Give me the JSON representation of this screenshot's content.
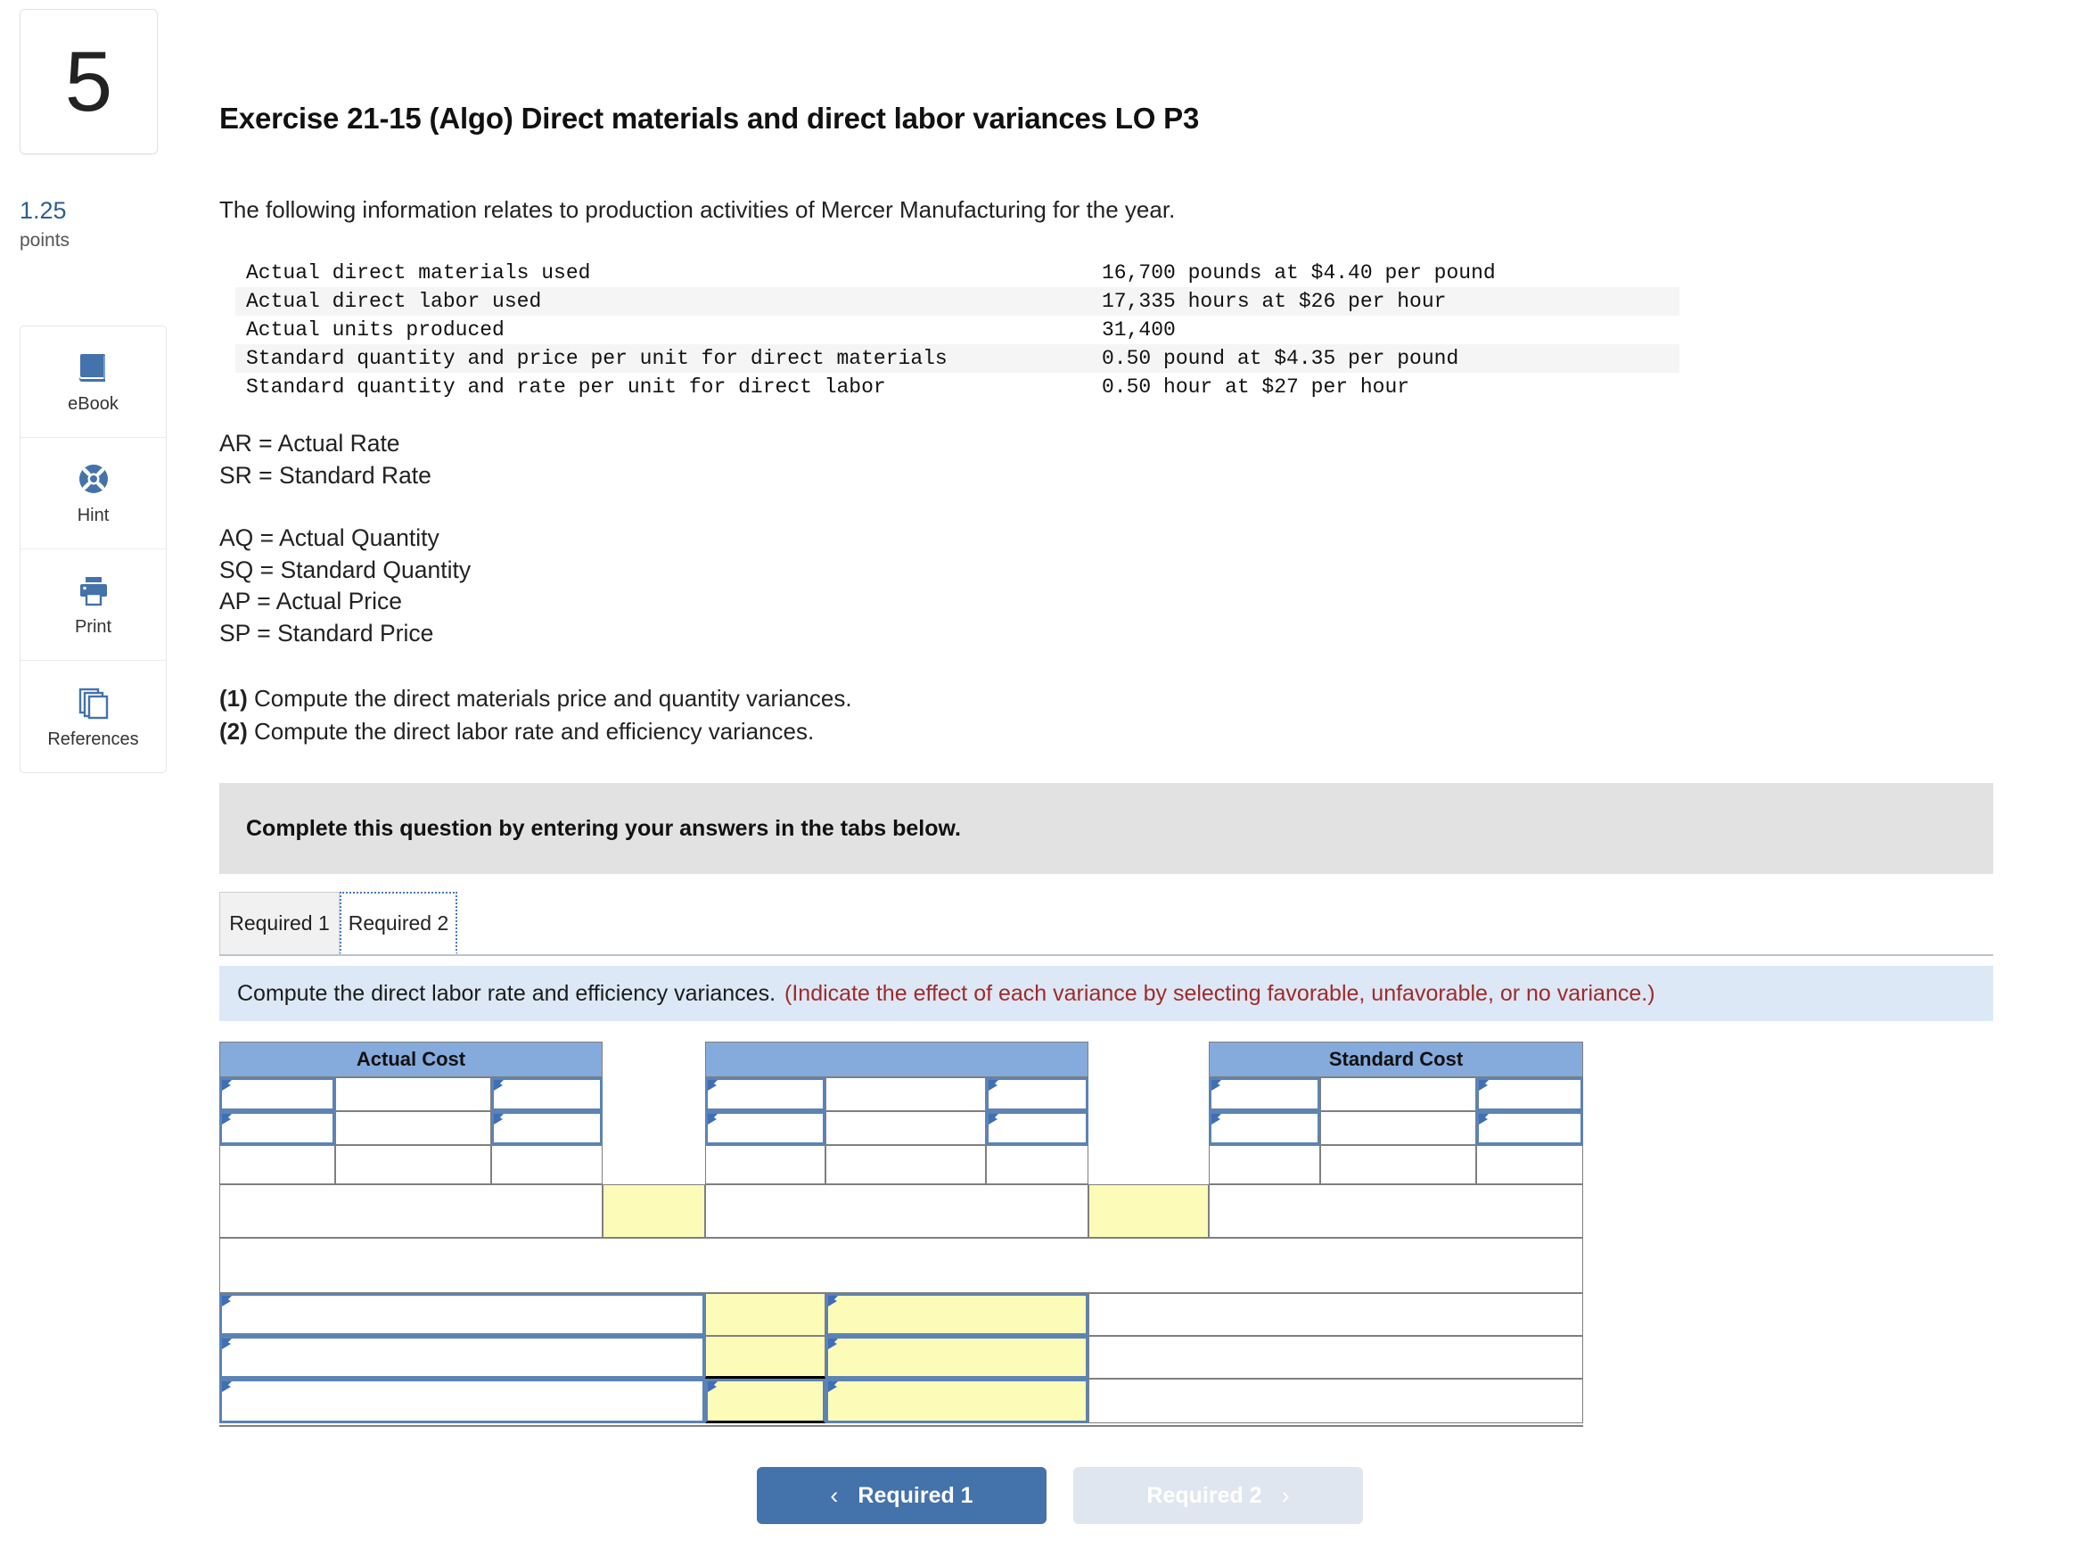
{
  "left_rail": {
    "question_number": "5",
    "points_value": "1.25",
    "points_label": "points",
    "tools": [
      {
        "icon": "ebook-icon",
        "label": "eBook"
      },
      {
        "icon": "hint-lifebuoy-icon",
        "label": "Hint"
      },
      {
        "icon": "printer-icon",
        "label": "Print"
      },
      {
        "icon": "references-pages-icon",
        "label": "References"
      }
    ]
  },
  "exercise": {
    "title": "Exercise 21-15 (Algo) Direct materials and direct labor variances LO P3",
    "intro": "The following information relates to production activities of Mercer Manufacturing for the year."
  },
  "facts_table": {
    "rows": [
      {
        "label": "Actual direct materials used",
        "value": "16,700 pounds at $4.40 per pound"
      },
      {
        "label": "Actual direct labor used",
        "value": "17,335 hours at $26 per hour"
      },
      {
        "label": "Actual units produced",
        "value": "31,400"
      },
      {
        "label": "Standard quantity and price per unit for direct materials",
        "value": "0.50 pound at $4.35 per pound"
      },
      {
        "label": "Standard quantity and rate per unit for direct labor",
        "value": "0.50 hour at $27 per hour"
      }
    ]
  },
  "definitions": {
    "group1": [
      "AR = Actual Rate",
      "SR = Standard Rate"
    ],
    "group2": [
      "AQ = Actual Quantity",
      "SQ = Standard Quantity",
      "AP = Actual Price",
      "SP = Standard Price"
    ]
  },
  "requirements": [
    {
      "num": "(1)",
      "text": " Compute the direct materials price and quantity variances."
    },
    {
      "num": "(2)",
      "text": " Compute the direct labor rate and efficiency variances."
    }
  ],
  "complete_banner": "Complete this question by entering your answers in the tabs below.",
  "tabs": [
    {
      "label": "Required 1",
      "active": false
    },
    {
      "label": "Required 2",
      "active": true
    }
  ],
  "instruction": {
    "main": "Compute the direct labor rate and efficiency variances.",
    "hint": "(Indicate the effect of each variance by selecting favorable, unfavorable, or no variance.)"
  },
  "answer_grid": {
    "headers": [
      {
        "label": "Actual Cost"
      },
      {
        "label": ""
      },
      {
        "label": "Standard Cost"
      }
    ],
    "cells": []
  },
  "nav": {
    "prev_label": "Required 1",
    "next_label": "Required 2",
    "prev_chevron": "‹",
    "next_chevron": "›"
  },
  "colors": {
    "header_blue": "#85aadc",
    "input_yellow": "#fcfcb8",
    "select_border": "#5c83b4",
    "banner_gray": "#e2e2e2",
    "instruction_blue": "#dce8f5",
    "hint_red": "#a02a2a",
    "primary_button": "#4472ab",
    "points_blue": "#2c5f91"
  }
}
